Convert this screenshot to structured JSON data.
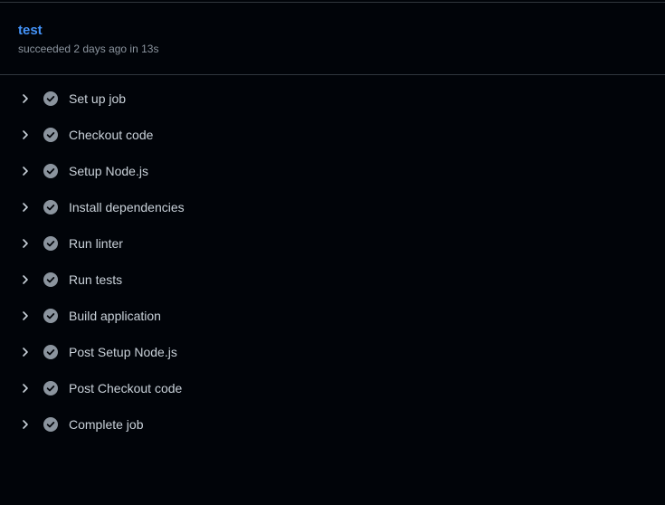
{
  "job": {
    "title": "test",
    "status_text": "succeeded 2 days ago in 13s"
  },
  "colors": {
    "background": "#010409",
    "title": "#4493f8",
    "muted": "#8b949e",
    "text": "#c9d1d9",
    "success_icon": "#8b949e"
  },
  "icons": {
    "expand": "chevron-right-icon",
    "status": "check-circle-icon"
  },
  "steps": [
    {
      "label": "Set up job"
    },
    {
      "label": "Checkout code"
    },
    {
      "label": "Setup Node.js"
    },
    {
      "label": "Install dependencies"
    },
    {
      "label": "Run linter"
    },
    {
      "label": "Run tests"
    },
    {
      "label": "Build application"
    },
    {
      "label": "Post Setup Node.js"
    },
    {
      "label": "Post Checkout code"
    },
    {
      "label": "Complete job"
    }
  ]
}
